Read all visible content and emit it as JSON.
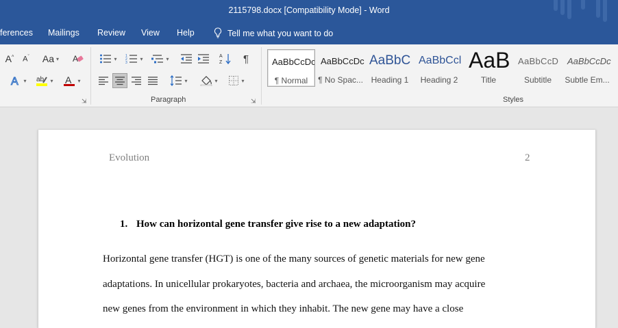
{
  "window": {
    "title": "2115798.docx [Compatibility Mode]  -  Word"
  },
  "tabs": [
    {
      "label": "ferences"
    },
    {
      "label": "Mailings"
    },
    {
      "label": "Review"
    },
    {
      "label": "View"
    },
    {
      "label": "Help"
    }
  ],
  "tell_me": {
    "label": "Tell me what you want to do"
  },
  "ribbon": {
    "font_group": {
      "change_case_label": "Aa"
    },
    "paragraph_group": {
      "label": "Paragraph"
    },
    "styles_group": {
      "label": "Styles",
      "items": [
        {
          "preview": "AaBbCcDc",
          "name": "¶ Normal"
        },
        {
          "preview": "AaBbCcDc",
          "name": "¶ No Spac..."
        },
        {
          "preview": "AaBbC",
          "name": "Heading 1"
        },
        {
          "preview": "AaBbCcl",
          "name": "Heading 2"
        },
        {
          "preview": "AaB",
          "name": "Title"
        },
        {
          "preview": "AaBbCcD",
          "name": "Subtitle"
        },
        {
          "preview": "AaBbCcDc",
          "name": "Subtle Em..."
        }
      ]
    }
  },
  "colors": {
    "accent": "#2b579a",
    "font_color": "#c00000",
    "highlight": "#ffff00"
  },
  "document": {
    "header_left": "Evolution",
    "page_number": "2",
    "question_number": "1.",
    "question": "How can horizontal gene transfer give rise to a new adaptation?",
    "paragraph_lines": [
      "Horizontal gene transfer (HGT) is one of the many sources of genetic materials for new gene",
      "adaptations. In unicellular prokaryotes, bacteria and archaea, the microorganism may acquire",
      "new genes from the environment in which they inhabit. The new gene may have a close"
    ]
  }
}
